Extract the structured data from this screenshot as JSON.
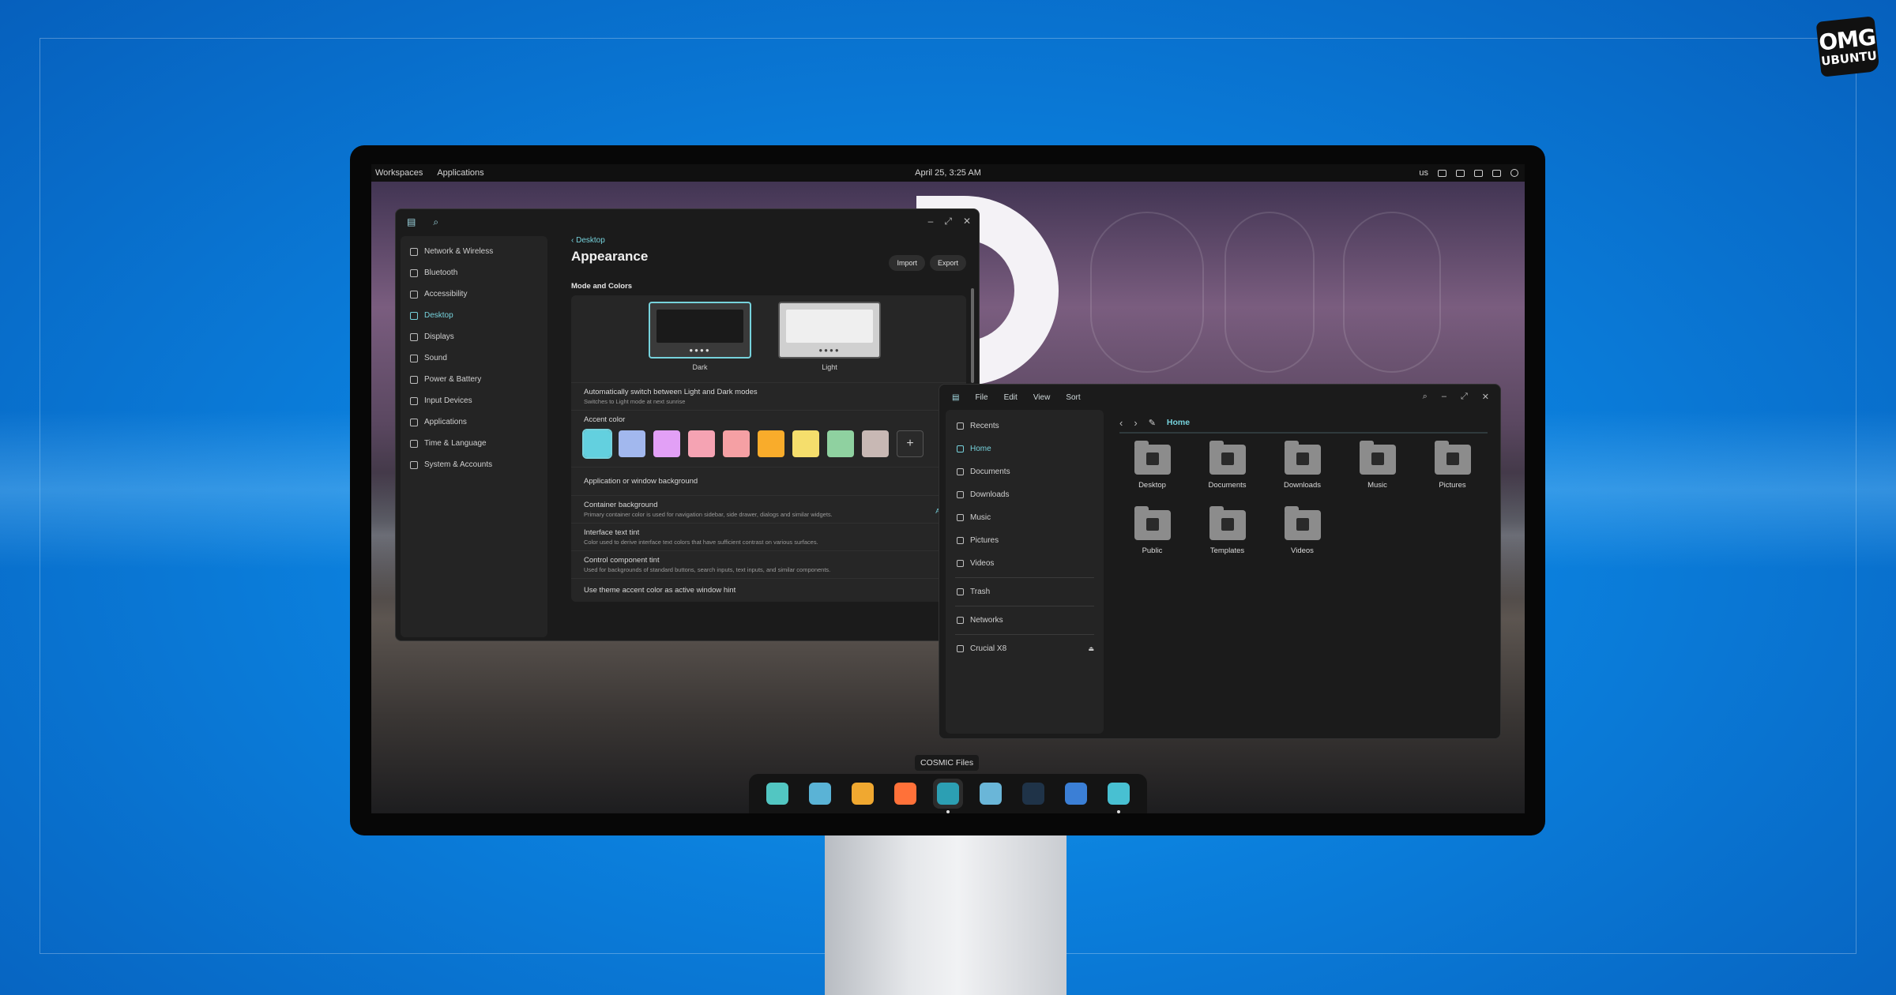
{
  "brand": {
    "line1": "OMG",
    "line2": "UBUNTU"
  },
  "topbar": {
    "workspaces": "Workspaces",
    "applications": "Applications",
    "datetime": "April 25, 3:25 AM",
    "keyboard": "us"
  },
  "settings": {
    "sidebar": [
      {
        "label": "Network & Wireless",
        "icon": "wifi-icon"
      },
      {
        "label": "Bluetooth",
        "icon": "bluetooth-icon"
      },
      {
        "label": "Accessibility",
        "icon": "accessibility-icon"
      },
      {
        "label": "Desktop",
        "icon": "desktop-icon",
        "active": true
      },
      {
        "label": "Displays",
        "icon": "display-icon"
      },
      {
        "label": "Sound",
        "icon": "speaker-icon"
      },
      {
        "label": "Power & Battery",
        "icon": "battery-icon"
      },
      {
        "label": "Input Devices",
        "icon": "keyboard-icon"
      },
      {
        "label": "Applications",
        "icon": "apps-icon"
      },
      {
        "label": "Time & Language",
        "icon": "clock-icon"
      },
      {
        "label": "System & Accounts",
        "icon": "users-icon"
      }
    ],
    "breadcrumb": "Desktop",
    "title": "Appearance",
    "import_label": "Import",
    "export_label": "Export",
    "section_mode": "Mode and Colors",
    "mode_dark": "Dark",
    "mode_light": "Light",
    "auto_switch": {
      "label": "Automatically switch between Light and Dark modes",
      "sub": "Switches to Light mode at next sunrise"
    },
    "accent_label": "Accent color",
    "accent_colors": [
      "#63d0df",
      "#a2b8ee",
      "#e2a0f6",
      "#f5a3b3",
      "#f5a0a4",
      "#f9ac2b",
      "#f5de6c",
      "#8fd1a0",
      "#c8b8b4"
    ],
    "add_color": "+",
    "app_bg": {
      "label": "Application or window background"
    },
    "container_bg": {
      "label": "Container background",
      "sub": "Primary container color is used for navigation sidebar, side drawer, dialogs and similar widgets.",
      "value": "Auto"
    },
    "text_tint": {
      "label": "Interface text tint",
      "sub": "Color used to derive interface text colors that have sufficient contrast on various surfaces."
    },
    "control_tint": {
      "label": "Control component tint",
      "sub": "Used for backgrounds of standard buttons, search inputs, text inputs, and similar components."
    },
    "accent_hint": {
      "label": "Use theme accent color as active window hint"
    }
  },
  "files": {
    "menu": [
      "File",
      "Edit",
      "View",
      "Sort"
    ],
    "sidebar": [
      {
        "label": "Recents",
        "icon": "clock-icon"
      },
      {
        "label": "Home",
        "icon": "home-icon",
        "active": true
      },
      {
        "label": "Documents",
        "icon": "document-icon"
      },
      {
        "label": "Downloads",
        "icon": "download-icon"
      },
      {
        "label": "Music",
        "icon": "music-icon"
      },
      {
        "label": "Pictures",
        "icon": "picture-icon"
      },
      {
        "label": "Videos",
        "icon": "video-icon"
      }
    ],
    "trash": "Trash",
    "networks": "Networks",
    "drive": "Crucial X8",
    "location": "Home",
    "folders": [
      "Desktop",
      "Documents",
      "Downloads",
      "Music",
      "Pictures",
      "Public",
      "Templates",
      "Videos"
    ]
  },
  "dock": {
    "tooltip": "COSMIC Files",
    "apps": [
      {
        "name": "dock-launcher",
        "color": "#52c6c2"
      },
      {
        "name": "dock-workspaces",
        "color": "#5ab3d6"
      },
      {
        "name": "dock-app-grid",
        "color": "#f0a830"
      },
      {
        "name": "dock-firefox",
        "color": "#ff7139"
      },
      {
        "name": "dock-files",
        "color": "#2c9fb3"
      },
      {
        "name": "dock-text-editor",
        "color": "#6ab6d8"
      },
      {
        "name": "dock-terminal",
        "color": "#1f3348"
      },
      {
        "name": "dock-store",
        "color": "#3b7fd6"
      },
      {
        "name": "dock-settings",
        "color": "#48c0d2"
      }
    ]
  }
}
